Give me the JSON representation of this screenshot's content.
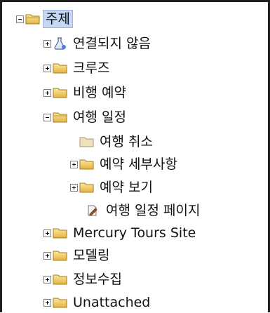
{
  "tree": {
    "root_label": "주제",
    "items": [
      {
        "label": "연결되지 않음"
      },
      {
        "label": "크루즈"
      },
      {
        "label": "비행 예약"
      },
      {
        "label": "여행 일정"
      },
      {
        "label": "여행 취소"
      },
      {
        "label": "예약 세부사항"
      },
      {
        "label": "예약 보기"
      },
      {
        "label": "여행 일정 페이지"
      },
      {
        "label": "Mercury Tours Site"
      },
      {
        "label": "모델링"
      },
      {
        "label": "정보수집"
      },
      {
        "label": "Unattached"
      }
    ]
  },
  "colors": {
    "selection": "#c4d8f6",
    "folder": "#f2c94c",
    "border": "#1e1e1e"
  }
}
